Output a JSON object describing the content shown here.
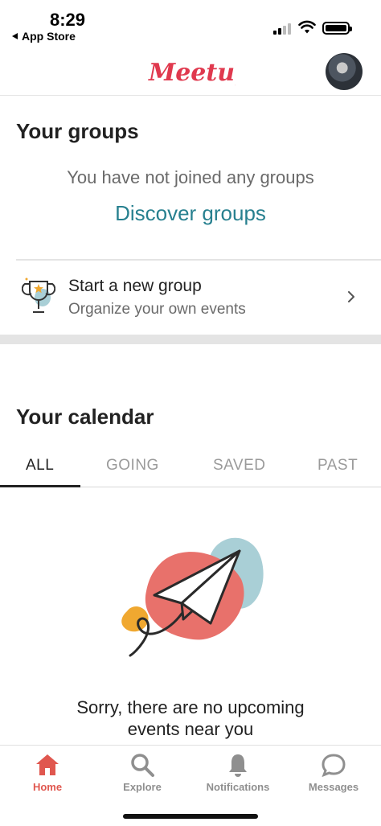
{
  "status_bar": {
    "time": "8:29",
    "back_label": "App Store"
  },
  "header": {
    "logo_text": "Meetup",
    "brand_color": "#e0394e",
    "avatar_icon": "user-avatar"
  },
  "groups": {
    "title": "Your groups",
    "empty_text": "You have not joined any groups",
    "discover_link": "Discover groups",
    "new_group": {
      "title": "Start a new group",
      "subtitle": "Organize your own events",
      "icon": "trophy-icon"
    }
  },
  "calendar": {
    "title": "Your calendar",
    "tabs": [
      {
        "label": "ALL",
        "active": true
      },
      {
        "label": "GOING",
        "active": false
      },
      {
        "label": "SAVED",
        "active": false
      },
      {
        "label": "PAST",
        "active": false
      }
    ],
    "empty_line1": "Sorry, there are no upcoming",
    "empty_line2": "events near you"
  },
  "bottom_nav": [
    {
      "label": "Home",
      "icon": "home-icon",
      "active": true
    },
    {
      "label": "Explore",
      "icon": "search-icon",
      "active": false
    },
    {
      "label": "Notifications",
      "icon": "bell-icon",
      "active": false
    },
    {
      "label": "Messages",
      "icon": "chat-bubble-icon",
      "active": false
    }
  ],
  "colors": {
    "accent": "#e0574f",
    "link": "#27808f",
    "muted": "#6a6a6a"
  }
}
